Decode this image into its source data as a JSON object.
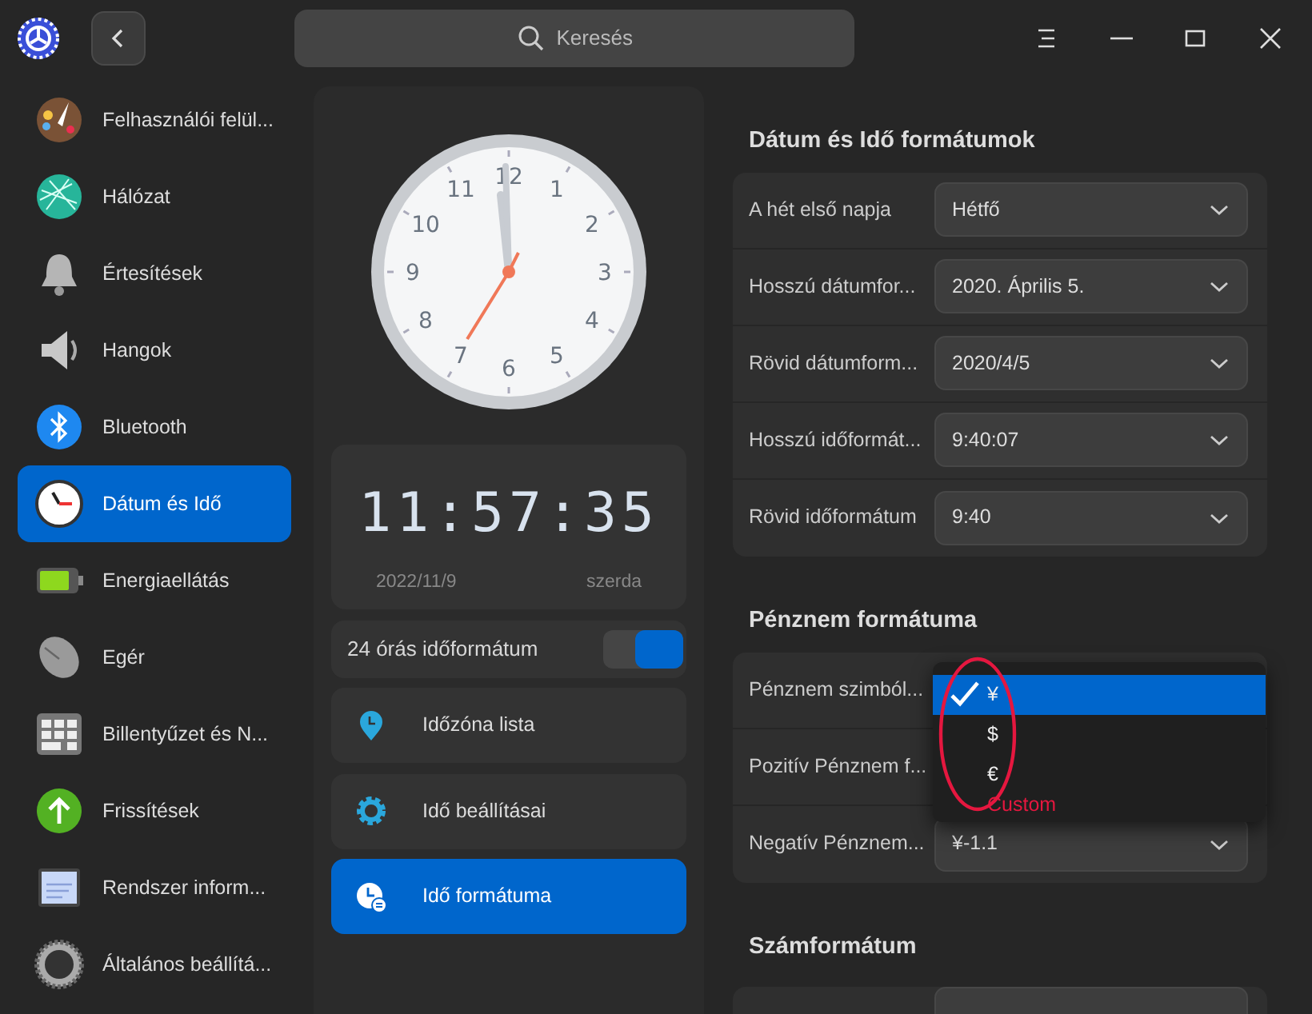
{
  "title_bar": {
    "search": {
      "placeholder": "Keresés"
    }
  },
  "sidebar": {
    "items": [
      {
        "label": "Felhasználói felül...",
        "kind": "palette",
        "selected": false
      },
      {
        "label": "Hálózat",
        "kind": "network",
        "selected": false
      },
      {
        "label": "Értesítések",
        "kind": "bell",
        "selected": false
      },
      {
        "label": "Hangok",
        "kind": "speaker",
        "selected": false
      },
      {
        "label": "Bluetooth",
        "kind": "bluetooth",
        "selected": false
      },
      {
        "label": "Dátum és Idő",
        "kind": "clock",
        "selected": true
      },
      {
        "label": "Energiaellátás",
        "kind": "battery",
        "selected": false
      },
      {
        "label": "Egér",
        "kind": "mouse",
        "selected": false
      },
      {
        "label": "Billentyűzet és N...",
        "kind": "keyboard",
        "selected": false
      },
      {
        "label": "Frissítések",
        "kind": "update",
        "selected": false
      },
      {
        "label": "Rendszer inform...",
        "kind": "sysinfo",
        "selected": false
      },
      {
        "label": "Általános beállítá...",
        "kind": "gear",
        "selected": false
      }
    ]
  },
  "clock": {
    "numbers": [
      "12",
      "1",
      "2",
      "3",
      "4",
      "5",
      "6",
      "7",
      "8",
      "9",
      "10",
      "11"
    ],
    "digital_time": "11:57:35",
    "date": "2022/11/9",
    "weekday": "szerda"
  },
  "time_format_24h": {
    "label": "24 órás időformátum",
    "on": true
  },
  "menu": [
    {
      "label": "Időzóna lista",
      "kind": "pin",
      "selected": false
    },
    {
      "label": "Idő beállításai",
      "kind": "gear",
      "selected": false
    },
    {
      "label": "Idő formátuma",
      "kind": "format",
      "selected": true
    }
  ],
  "sections": [
    {
      "title": "Dátum és Idő formátumok",
      "rows": [
        {
          "label": "A hét első napja",
          "value": "Hétfő"
        },
        {
          "label": "Hosszú dátumfor...",
          "value": "2020. Április 5."
        },
        {
          "label": "Rövid dátumform...",
          "value": "2020/4/5"
        },
        {
          "label": "Hosszú időformát...",
          "value": "9:40:07"
        },
        {
          "label": "Rövid időformátum",
          "value": "9:40"
        }
      ]
    },
    {
      "title": "Pénznem formátuma",
      "rows": [
        {
          "label": "Pénznem szimból...",
          "open": true,
          "options": [
            {
              "label": "¥",
              "selected": true
            },
            {
              "label": "$",
              "selected": false
            },
            {
              "label": "€",
              "selected": false
            }
          ]
        },
        {
          "label": "Pozitív Pénznem f..."
        },
        {
          "label": "Negatív Pénznem...",
          "value": "¥-1.1"
        }
      ]
    },
    {
      "title": "Számformátum"
    }
  ],
  "annotation": {
    "label": "Custom"
  }
}
